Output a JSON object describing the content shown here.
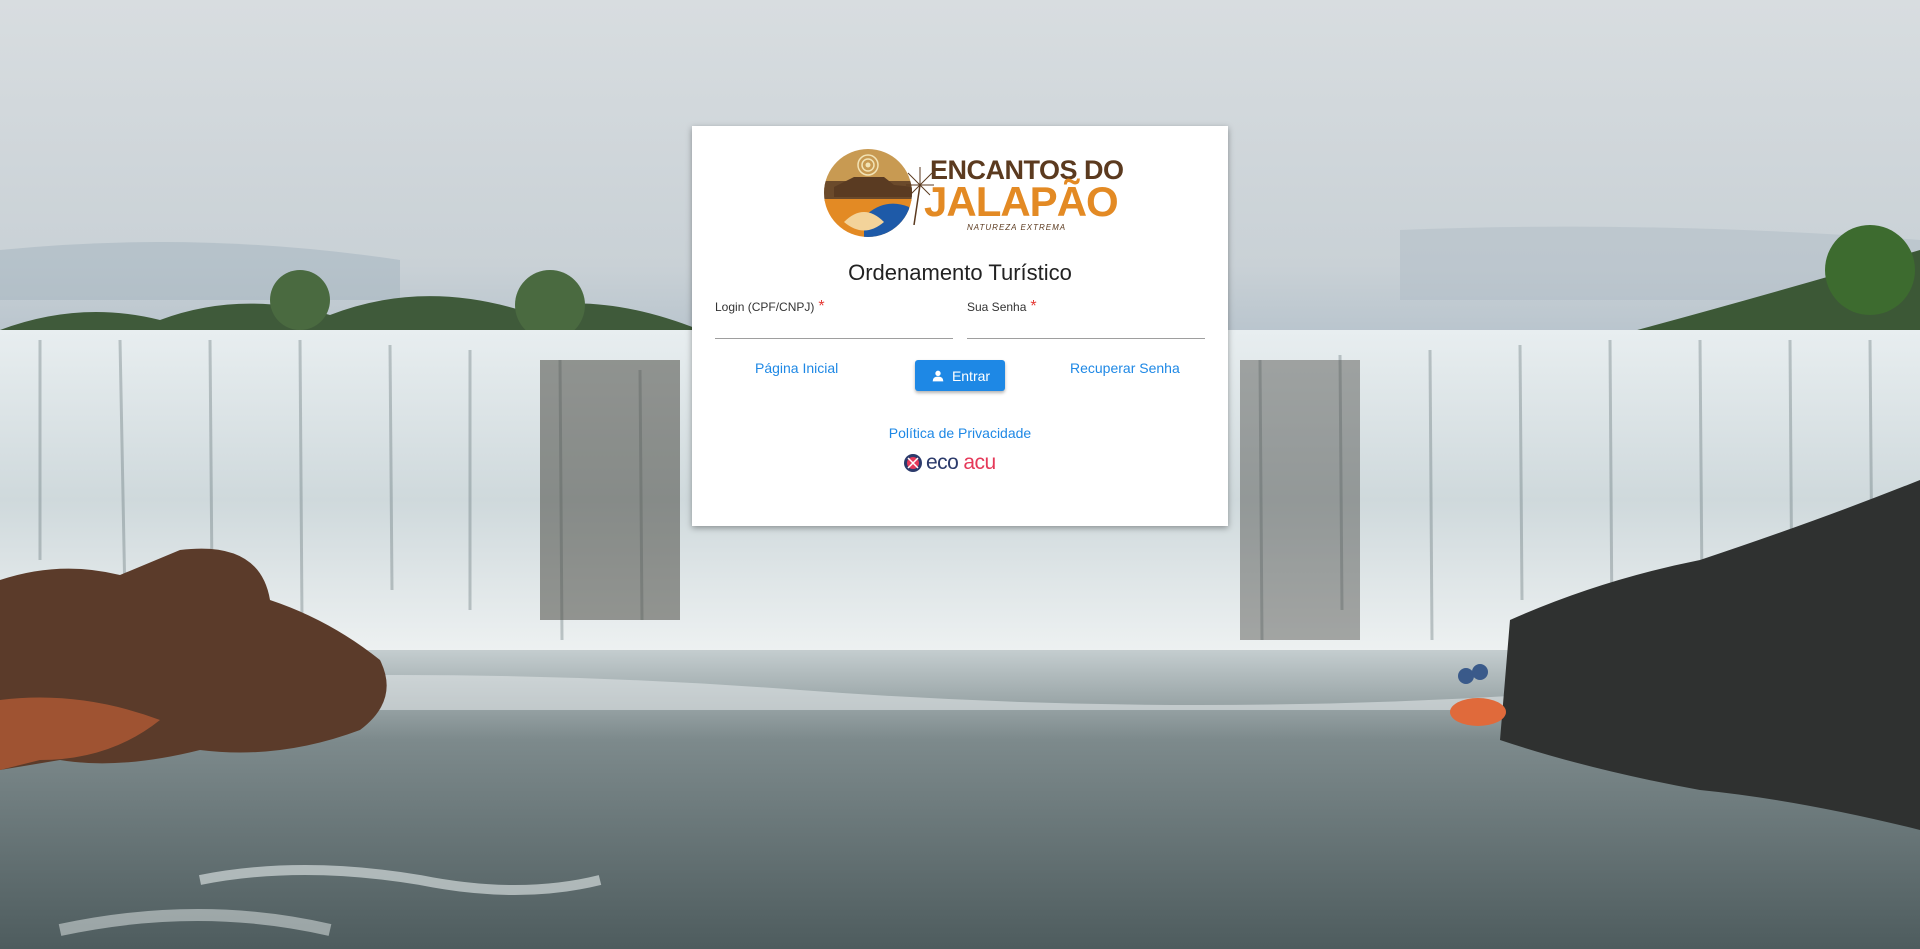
{
  "logo": {
    "line1": "ENCANTOS DO",
    "line2": "JALAPÃO",
    "tagline": "NATUREZA   EXTREMA"
  },
  "page_title": "Ordenamento Turístico",
  "form": {
    "login_label": "Login (CPF/CNPJ)",
    "login_required": "*",
    "login_value": "",
    "password_label": "Sua Senha",
    "password_required": "*",
    "password_value": ""
  },
  "actions": {
    "home_link": "Página Inicial",
    "submit_label": "Entrar",
    "submit_icon": "person-icon",
    "recover_link": "Recuperar Senha"
  },
  "privacy_link": "Política de Privacidade",
  "partner_logo": {
    "word1": "eco",
    "word2": "acu"
  },
  "colors": {
    "accent": "#1e88e5",
    "required": "#e53935",
    "logo_brown": "#5b3a1f",
    "logo_orange": "#e38a24"
  }
}
